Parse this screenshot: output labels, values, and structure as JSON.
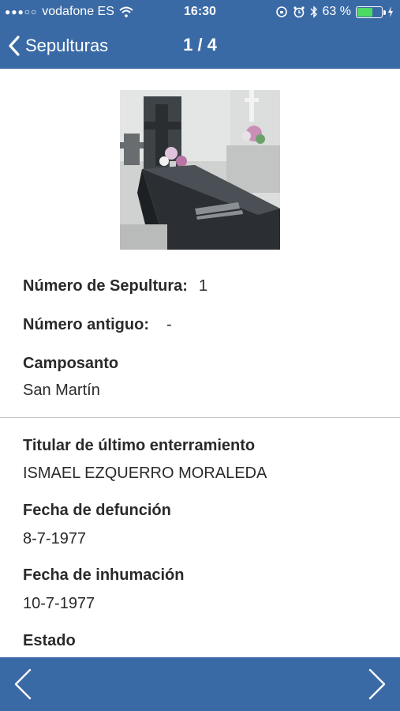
{
  "status_bar": {
    "signal": "●●●○○",
    "carrier": "vodafone ES",
    "time": "16:30",
    "battery_percent": "63 %",
    "battery_level": 0.63
  },
  "nav": {
    "back_label": "Sepulturas",
    "title": "1 / 4"
  },
  "details": {
    "numero_label": "Número de Sepultura:",
    "numero_value": "1",
    "antiguo_label": "Número antiguo:",
    "antiguo_value": "-",
    "camposanto_label": "Camposanto",
    "camposanto_value": "San Martín",
    "titular_label": "Titular de último enterramiento",
    "titular_value": "ISMAEL EZQUERRO MORALEDA",
    "defuncion_label": "Fecha de defunción",
    "defuncion_value": "8-7-1977",
    "inhumacion_label": "Fecha de inhumación",
    "inhumacion_value": "10-7-1977",
    "estado_label": "Estado"
  },
  "colors": {
    "bar": "#3a6aa5",
    "battery": "#4cd964"
  }
}
